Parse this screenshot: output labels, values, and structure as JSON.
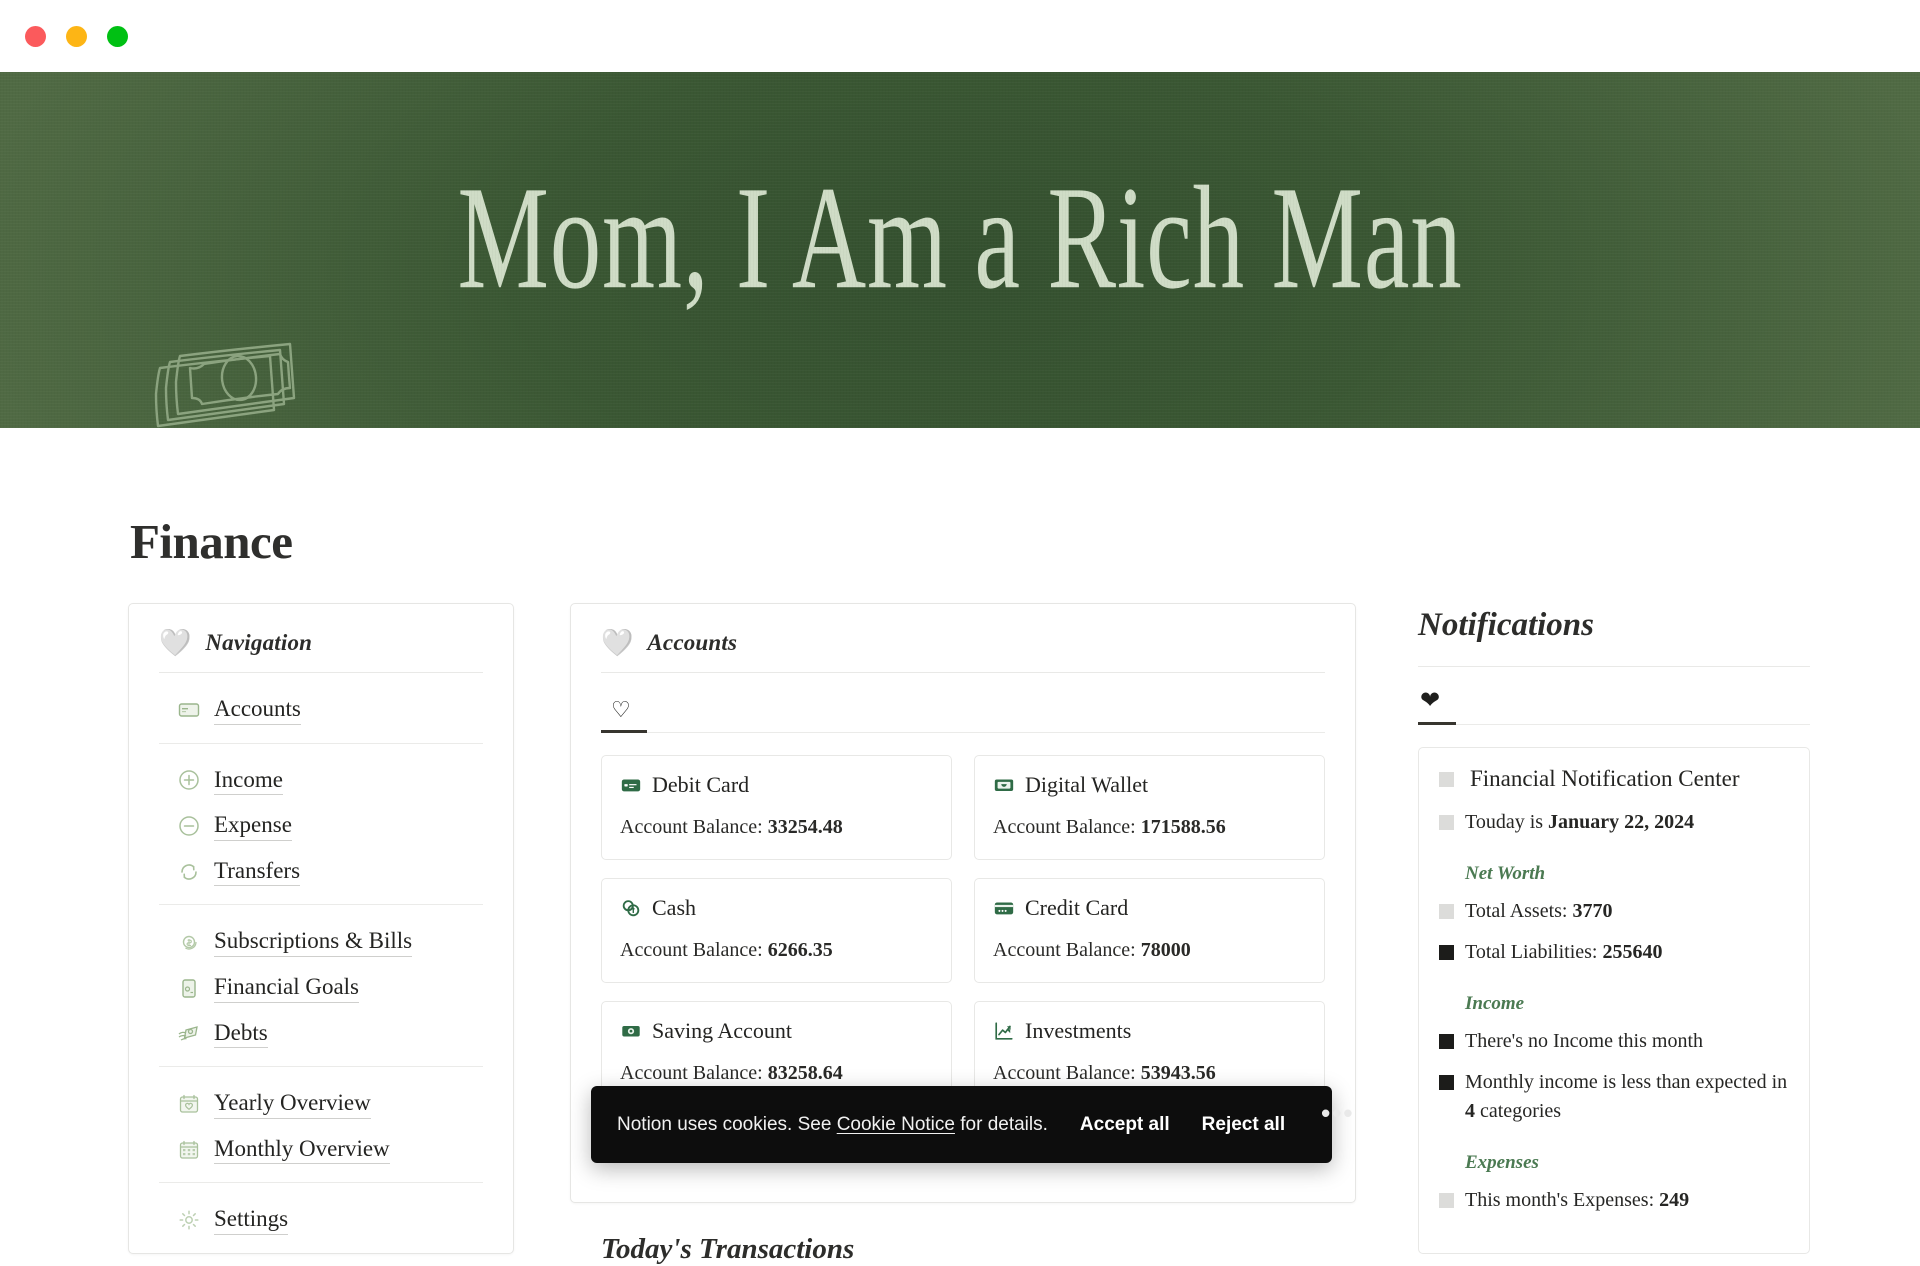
{
  "window": {
    "traffic_lights": [
      "close-red",
      "minimize-yellow",
      "zoom-green"
    ]
  },
  "cover": {
    "title": "Mom, I Am a Rich Man",
    "icon": "money-banknotes-icon",
    "gradient_from": "#506a44",
    "gradient_to": "#34502f"
  },
  "page": {
    "title": "Finance"
  },
  "navigation": {
    "heart_icon": "white-heart-icon",
    "title": "Navigation",
    "groups": [
      {
        "items": [
          {
            "label": "Accounts",
            "icon": "card-index-icon"
          }
        ]
      },
      {
        "items": [
          {
            "label": "Income",
            "icon": "plus-circle-icon"
          },
          {
            "label": "Expense",
            "icon": "minus-circle-icon"
          },
          {
            "label": "Transfers",
            "icon": "refresh-arrows-icon"
          }
        ]
      },
      {
        "items": [
          {
            "label": "Subscriptions & Bills",
            "icon": "recurring-dollar-icon"
          },
          {
            "label": "Financial Goals",
            "icon": "money-jar-icon"
          },
          {
            "label": "Debts",
            "icon": "money-with-wings-icon"
          }
        ]
      },
      {
        "items": [
          {
            "label": "Yearly Overview",
            "icon": "calendar-heart-icon"
          },
          {
            "label": "Monthly Overview",
            "icon": "calendar-grid-icon"
          }
        ]
      },
      {
        "items": [
          {
            "label": "Settings",
            "icon": "gear-icon"
          }
        ]
      }
    ]
  },
  "accounts": {
    "heart_icon": "white-heart-icon",
    "title": "Accounts",
    "tab_icon": "heart-outline-icon",
    "balance_label": "Account Balance:",
    "cards": [
      {
        "name": "Debit Card",
        "icon": "debit-card-icon",
        "balance": "33254.48"
      },
      {
        "name": "Digital Wallet",
        "icon": "digital-wallet-icon",
        "balance": "171588.56"
      },
      {
        "name": "Cash",
        "icon": "cash-coins-icon",
        "balance": "6266.35"
      },
      {
        "name": "Credit Card",
        "icon": "credit-card-icon",
        "balance": "78000"
      },
      {
        "name": "Saving Account",
        "icon": "savings-banknote-icon",
        "balance": "83258.64"
      },
      {
        "name": "Investments",
        "icon": "chart-up-icon",
        "balance": "53943.56"
      }
    ],
    "todays_transactions": "Today's Transactions"
  },
  "notifications": {
    "title": "Notifications",
    "tab_icon": "heart-filled-icon",
    "card": {
      "title": "Financial Notification Center",
      "title_bullet": "light-square-bullet",
      "date_line_prefix": "Touday is ",
      "date": "January 22, 2024",
      "sections": [
        {
          "heading": "Net Worth",
          "lines": [
            {
              "bullet": "light",
              "text": "Total Assets: ",
              "value": "3770"
            },
            {
              "bullet": "dark",
              "text": "Total Liabilities: ",
              "value": "255640"
            }
          ]
        },
        {
          "heading": "Income",
          "lines": [
            {
              "bullet": "dark",
              "text": "There's no Income this month",
              "value": ""
            },
            {
              "bullet": "dark",
              "text": "Monthly income is less than expected in ",
              "value": "4",
              "suffix": " categories"
            }
          ]
        },
        {
          "heading": "Expenses",
          "lines": [
            {
              "bullet": "light",
              "text": "This month's Expenses: ",
              "value": "249"
            }
          ]
        }
      ]
    }
  },
  "cookie_banner": {
    "text_before_link": "Notion uses cookies. See ",
    "link": "Cookie Notice",
    "text_after_link": " for details.",
    "accept_label": "Accept all",
    "reject_label": "Reject all",
    "more_label": "•••"
  }
}
